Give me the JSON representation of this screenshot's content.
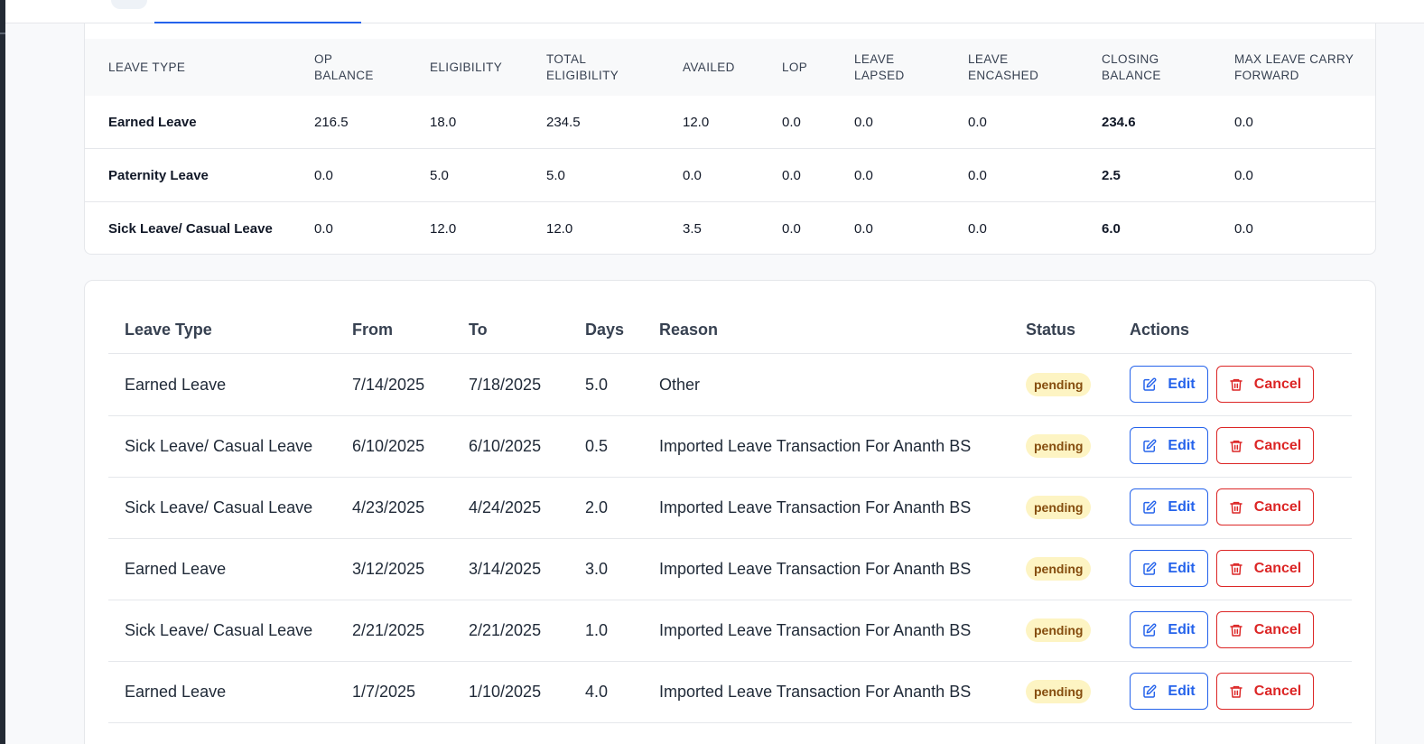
{
  "summary": {
    "headers": {
      "leave_type": "LEAVE TYPE",
      "op_balance": "OP BALANCE",
      "eligibility": "ELIGIBILITY",
      "total_eligibility": "TOTAL ELIGIBILITY",
      "availed": "AVAILED",
      "lop": "LOP",
      "leave_lapsed": "LEAVE LAPSED",
      "leave_encashed": "LEAVE ENCASHED",
      "closing_balance": "CLOSING BALANCE",
      "max_carry_forward": "MAX LEAVE CARRY FORWARD"
    },
    "rows": [
      {
        "leave_type": "Earned Leave",
        "op_balance": "216.5",
        "eligibility": "18.0",
        "total_eligibility": "234.5",
        "availed": "12.0",
        "lop": "0.0",
        "leave_lapsed": "0.0",
        "leave_encashed": "0.0",
        "closing_balance": "234.6",
        "max_carry_forward": "0.0"
      },
      {
        "leave_type": "Paternity Leave",
        "op_balance": "0.0",
        "eligibility": "5.0",
        "total_eligibility": "5.0",
        "availed": "0.0",
        "lop": "0.0",
        "leave_lapsed": "0.0",
        "leave_encashed": "0.0",
        "closing_balance": "2.5",
        "max_carry_forward": "0.0"
      },
      {
        "leave_type": "Sick Leave/ Casual Leave",
        "op_balance": "0.0",
        "eligibility": "12.0",
        "total_eligibility": "12.0",
        "availed": "3.5",
        "lop": "0.0",
        "leave_lapsed": "0.0",
        "leave_encashed": "0.0",
        "closing_balance": "6.0",
        "max_carry_forward": "0.0"
      }
    ]
  },
  "requests": {
    "headers": {
      "leave_type": "Leave Type",
      "from": "From",
      "to": "To",
      "days": "Days",
      "reason": "Reason",
      "status": "Status",
      "actions": "Actions"
    },
    "edit_label": "Edit",
    "cancel_label": "Cancel",
    "rows": [
      {
        "leave_type": "Earned Leave",
        "from": "7/14/2025",
        "to": "7/18/2025",
        "days": "5.0",
        "reason": "Other",
        "status": "pending"
      },
      {
        "leave_type": "Sick Leave/ Casual Leave",
        "from": "6/10/2025",
        "to": "6/10/2025",
        "days": "0.5",
        "reason": "Imported Leave Transaction For Ananth BS",
        "status": "pending"
      },
      {
        "leave_type": "Sick Leave/ Casual Leave",
        "from": "4/23/2025",
        "to": "4/24/2025",
        "days": "2.0",
        "reason": "Imported Leave Transaction For Ananth BS",
        "status": "pending"
      },
      {
        "leave_type": "Earned Leave",
        "from": "3/12/2025",
        "to": "3/14/2025",
        "days": "3.0",
        "reason": "Imported Leave Transaction For Ananth BS",
        "status": "pending"
      },
      {
        "leave_type": "Sick Leave/ Casual Leave",
        "from": "2/21/2025",
        "to": "2/21/2025",
        "days": "1.0",
        "reason": "Imported Leave Transaction For Ananth BS",
        "status": "pending"
      },
      {
        "leave_type": "Earned Leave",
        "from": "1/7/2025",
        "to": "1/10/2025",
        "days": "4.0",
        "reason": "Imported Leave Transaction For Ananth BS",
        "status": "pending"
      }
    ]
  },
  "icons": {
    "edit": "edit-icon",
    "cancel": "trash-icon"
  },
  "colors": {
    "edit": "#2563eb",
    "cancel": "#dc2626",
    "pending_bg": "#fdf4c3",
    "pending_text": "#854d0e"
  }
}
